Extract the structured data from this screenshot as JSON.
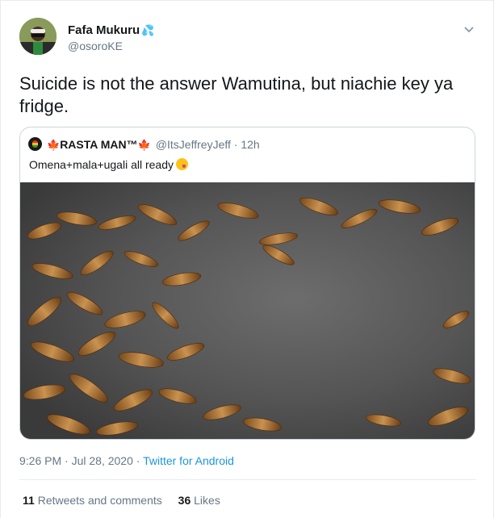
{
  "tweet": {
    "author": {
      "name": "Fafa Mukuru",
      "badge_emoji": "💦",
      "handle": "@osoroKE"
    },
    "text": "Suicide is not the answer Wamutina, but niachie key ya fridge.",
    "quoted": {
      "avatar_emoji": "🍁",
      "name_prefix_icon": "🍁",
      "name": "RASTA MAN™",
      "name_suffix_icon": "🍁",
      "handle": "@ItsJeffreyJeff",
      "time": "· 12h",
      "text": "Omena+mala+ugali all ready",
      "text_emoji": "yum-face-emoji",
      "image": "fried omena fish in a pan"
    },
    "timestamp": "9:26 PM · Jul 28, 2020 · ",
    "source": "Twitter for Android",
    "stats": {
      "retweets_count": "11",
      "retweets_label": "Retweets and comments",
      "likes_count": "36",
      "likes_label": "Likes"
    }
  }
}
